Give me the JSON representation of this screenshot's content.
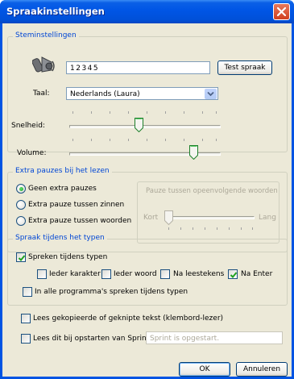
{
  "window": {
    "title": "Spraakinstellingen"
  },
  "voice": {
    "legend": "Steminstellingen",
    "test_text": "12345",
    "test_button": "Test spraak",
    "language_label": "Taal:",
    "language_value": "Nederlands (Laura)",
    "speed_label": "Snelheid:",
    "speed_level": 0.46,
    "volume_label": "Volume:",
    "volume_level": 0.84
  },
  "pauses": {
    "legend": "Extra pauzes bij het lezen",
    "options": [
      "Geen extra pauzes",
      "Extra pauze tussen zinnen",
      "Extra pauze tussen woorden"
    ],
    "selected": 0,
    "word_pause_label": "Pauze tussen opeenvolgende woorden",
    "short_label": "Kort",
    "long_label": "Lang",
    "word_pause_level": 0.0
  },
  "typing": {
    "legend": "Spraak tijdens het typen",
    "speak_while_typing": "Spreken tijdens typen",
    "speak_while_typing_checked": true,
    "each_character": "Ieder karakter",
    "each_character_checked": false,
    "each_word": "Ieder woord",
    "each_word_checked": false,
    "after_punctuation": "Na leestekens",
    "after_punctuation_checked": false,
    "after_enter": "Na Enter",
    "after_enter_checked": true,
    "all_programs": "In alle programma's spreken tijdens typen",
    "all_programs_checked": false
  },
  "clipboard": {
    "label": "Lees gekopieerde of geknipte tekst (klembord-lezer)",
    "checked": false
  },
  "startup": {
    "label": "Lees dit bij opstarten van Sprint:",
    "checked": false,
    "placeholder": "Sprint is opgestart."
  },
  "buttons": {
    "ok": "OK",
    "cancel": "Annuleren"
  }
}
